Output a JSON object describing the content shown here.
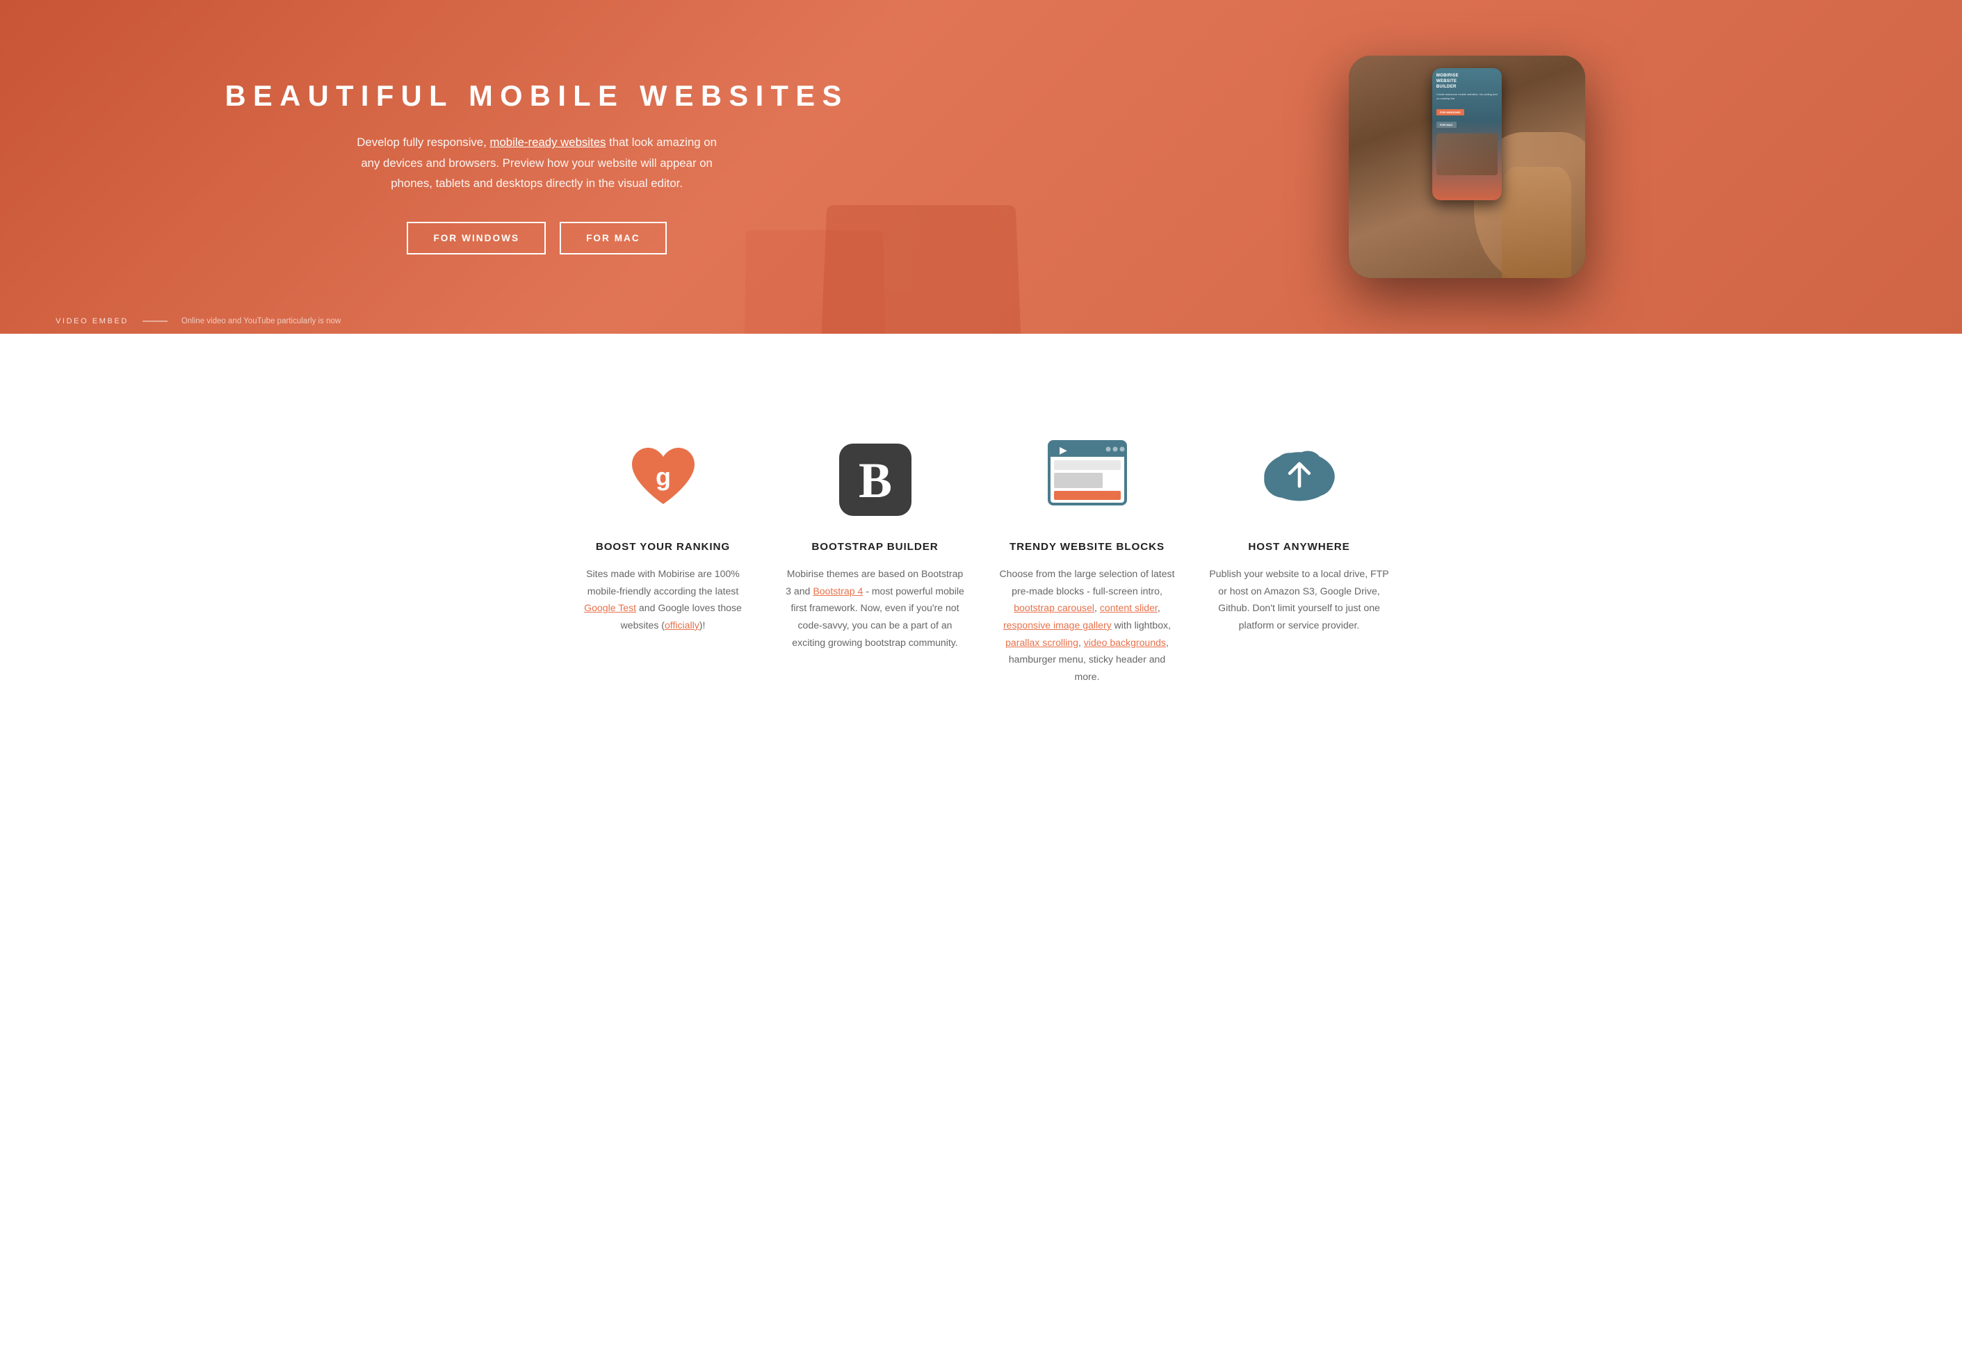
{
  "hero": {
    "title": "BEAUTIFUL MOBILE WEBSITES",
    "description_part1": "Develop fully responsive,",
    "description_link": "mobile-ready websites",
    "description_part2": "that look amazing on any devices and browsers. Preview how your website will appear on phones, tablets and desktops directly in the visual editor.",
    "btn_windows": "FOR WINDOWS",
    "btn_mac": "FOR MAC",
    "phone_brand": "MOBIRISE\nWEBSITE\nBUILDER",
    "phone_tagline": "Create awesome mobile websites. No coding and no monthly fee.",
    "phone_btn": "FOR WINDOWS"
  },
  "video_embed": {
    "label": "VIDEO EMBED",
    "text": "Online video and YouTube particularly is now"
  },
  "features": [
    {
      "id": "boost",
      "title": "BOOST YOUR RANKING",
      "desc_parts": [
        "Sites made with Mobirise are 100% mobile-friendly according the latest ",
        "Google Test",
        " and Google loves those websites (",
        "officially",
        ")!"
      ],
      "links": [
        {
          "text": "Google Test",
          "url": "#"
        },
        {
          "text": "officially",
          "url": "#"
        }
      ]
    },
    {
      "id": "bootstrap",
      "title": "BOOTSTRAP BUILDER",
      "desc_parts": [
        "Mobirise themes are based on Bootstrap 3 and ",
        "Bootstrap 4",
        " - most powerful mobile first framework. Now, even if you're not code-savvy, you can be a part of an exciting growing bootstrap community."
      ],
      "links": [
        {
          "text": "Bootstrap 4",
          "url": "#"
        }
      ]
    },
    {
      "id": "trendy",
      "title": "TRENDY WEBSITE BLOCKS",
      "desc_parts": [
        "Choose from the large selection of latest pre-made blocks - full-screen intro, ",
        "bootstrap carousel",
        ", ",
        "content slider",
        ", ",
        "responsive image gallery",
        " with lightbox, ",
        "parallax scrolling",
        ", ",
        "video backgrounds",
        ", hamburger menu, sticky header and more."
      ]
    },
    {
      "id": "host",
      "title": "HOST ANYWHERE",
      "desc": "Publish your website to a local drive, FTP or host on Amazon S3, Google Drive, Github. Don't limit yourself to just one platform or service provider."
    }
  ],
  "colors": {
    "primary": "#e8714a",
    "dark": "#3d3d3d",
    "teal": "#4a7b8c",
    "text_gray": "#666666",
    "text_dark": "#222222",
    "white": "#ffffff"
  }
}
